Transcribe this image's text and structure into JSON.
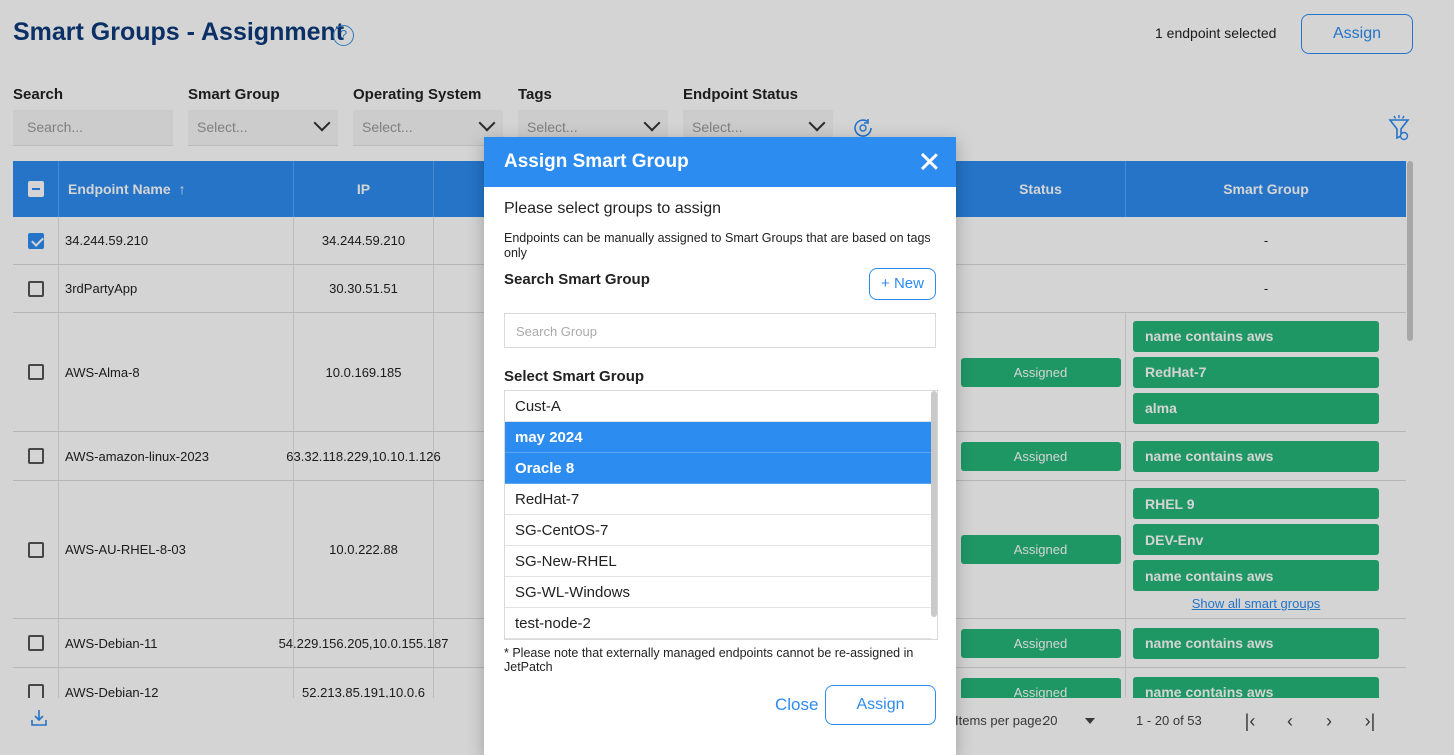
{
  "header": {
    "title": "Smart Groups - Assignment",
    "help_glyph": "?",
    "selected_text": "1 endpoint selected",
    "assign_label": "Assign"
  },
  "filters": [
    {
      "label": "Search",
      "placeholder": "Search...",
      "type": "input"
    },
    {
      "label": "Smart Group",
      "placeholder": "Select...",
      "type": "select"
    },
    {
      "label": "Operating System",
      "placeholder": "Select...",
      "type": "select"
    },
    {
      "label": "Tags",
      "placeholder": "Select...",
      "type": "select"
    },
    {
      "label": "Endpoint Status",
      "placeholder": "Select...",
      "type": "select"
    }
  ],
  "table": {
    "columns": {
      "name": "Endpoint Name",
      "ip": "IP",
      "status": "Status",
      "smart_group": "Smart Group"
    },
    "rows": [
      {
        "checked": true,
        "name": "34.244.59.210",
        "ip": "34.244.59.210",
        "status": "",
        "groups": [],
        "group_text": "-"
      },
      {
        "checked": false,
        "name": "3rdPartyApp",
        "ip": "30.30.51.51",
        "status": "",
        "groups": [],
        "group_text": "-"
      },
      {
        "checked": false,
        "name": "AWS-Alma-8",
        "ip": "10.0.169.185",
        "status": "Assigned",
        "groups": [
          "name contains aws",
          "RedHat-7",
          "alma"
        ]
      },
      {
        "checked": false,
        "name": "AWS-amazon-linux-2023",
        "ip": "63.32.118.229,10.10.1.126",
        "status": "Assigned",
        "groups": [
          "name contains aws"
        ]
      },
      {
        "checked": false,
        "name": "AWS-AU-RHEL-8-03",
        "ip": "10.0.222.88",
        "status": "Assigned",
        "groups": [
          "RHEL 9",
          "DEV-Env",
          "name contains aws"
        ],
        "show_all": "Show all smart groups"
      },
      {
        "checked": false,
        "name": "AWS-Debian-11",
        "ip": "54.229.156.205,10.0.155.187",
        "status": "Assigned",
        "groups": [
          "name contains aws"
        ]
      },
      {
        "checked": false,
        "name": "AWS-Debian-12",
        "ip": "52.213.85.191,10.0.6",
        "status": "Assigned",
        "groups": [
          "name contains aws"
        ]
      }
    ]
  },
  "footer": {
    "items_per_page_label": "Items per page:",
    "items_per_page_value": "20",
    "range_text": "1 - 20 of 53"
  },
  "modal": {
    "title": "Assign Smart Group",
    "subtitle": "Please select groups to assign",
    "note": "Endpoints can be manually assigned to Smart Groups that are based on tags only",
    "search_label": "Search Smart Group",
    "new_label": "+ New",
    "search_placeholder": "Search Group",
    "select_label": "Select Smart Group",
    "items": [
      {
        "label": "Cust-A",
        "selected": false
      },
      {
        "label": "may 2024",
        "selected": true
      },
      {
        "label": "Oracle 8",
        "selected": true
      },
      {
        "label": "RedHat-7",
        "selected": false
      },
      {
        "label": "SG-CentOS-7",
        "selected": false
      },
      {
        "label": "SG-New-RHEL",
        "selected": false
      },
      {
        "label": "SG-WL-Windows",
        "selected": false
      },
      {
        "label": "test-node-2",
        "selected": false
      }
    ],
    "footnote": "* Please note that externally managed endpoints cannot be re-assigned in JetPatch",
    "close_label": "Close",
    "assign_label": "Assign"
  },
  "colors": {
    "primary": "#2d8cf0",
    "title": "#0d3a7a",
    "success": "#26b67a"
  }
}
